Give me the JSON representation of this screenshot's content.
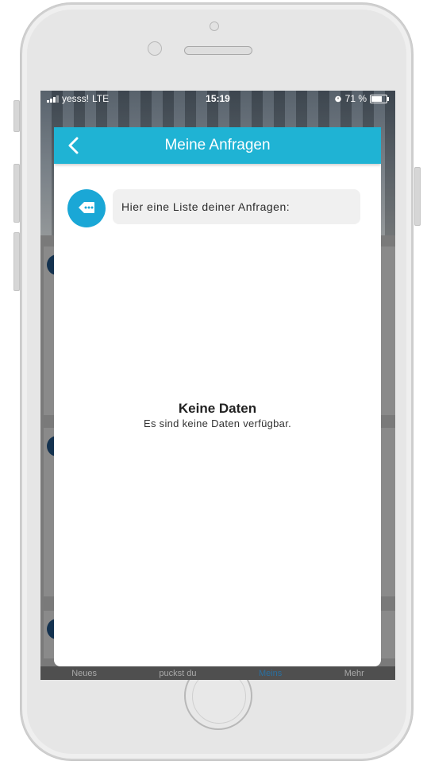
{
  "status_bar": {
    "carrier": "yesss!",
    "network": "LTE",
    "time": "15:19",
    "battery": "71 %"
  },
  "dialog": {
    "title": "Meine Anfragen",
    "intro_text": "Hier eine Liste deiner Anfragen:",
    "empty_title": "Keine Daten",
    "empty_subtitle": "Es sind keine Daten verfügbar."
  },
  "tab_bar": {
    "items": [
      "Neues",
      "puckst du",
      "Meins",
      "Mehr"
    ],
    "active_index": 2
  },
  "colors": {
    "header": "#1fb3d4",
    "avatar": "#1aa7d6",
    "active_tab": "#2a6fa0"
  },
  "icons": {
    "back": "chevron-left-icon",
    "avatar": "chat-tag-icon",
    "alarm": "alarm-icon",
    "battery": "battery-icon",
    "signal": "signal-icon"
  }
}
